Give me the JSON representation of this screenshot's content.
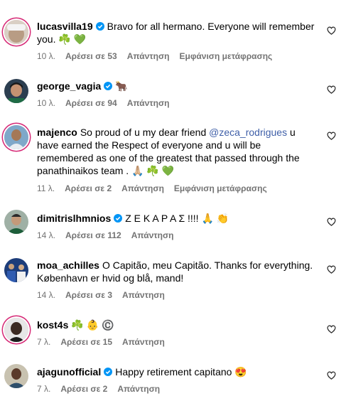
{
  "comments": [
    {
      "username": "lucasvilla19",
      "text": "Bravo for all hermano. Everyone will remember you. ☘️ 💚",
      "time": "10 λ.",
      "likes": "Αρέσει σε 53",
      "reply": "Απάντηση",
      "translate": "Εμφάνιση μετάφρασης"
    },
    {
      "username": "george_vagia",
      "text": "🐂",
      "time": "10 λ.",
      "likes": "Αρέσει σε 94",
      "reply": "Απάντηση"
    },
    {
      "username": "majenco",
      "text_before": "So proud of u my dear friend ",
      "mention": "@zeca_rodrigues",
      "text_after": " u have earned the Respect of everyone and u will be remembered as one of the greatest that passed through the panathinaikos team . 🙏🏼 ☘️ 💚",
      "time": "11 λ.",
      "likes": "Αρέσει σε 2",
      "reply": "Απάντηση",
      "translate": "Εμφάνιση μετάφρασης"
    },
    {
      "username": "dimitrislhmnios",
      "text": "Ζ Ε Κ Α Ρ Α Σ !!!! 🙏 👏",
      "time": "14 λ.",
      "likes": "Αρέσει σε 112",
      "reply": "Απάντηση"
    },
    {
      "username": "moa_achilles",
      "text": "O Capitão, meu Capitão. Thanks for everything. København er hvid og blå, mand!",
      "time": "14 λ.",
      "likes": "Αρέσει σε 3",
      "reply": "Απάντηση"
    },
    {
      "username": "kost4s",
      "text": "☘️ 👶 ©️",
      "time": "7 λ.",
      "likes": "Αρέσει σε 15",
      "reply": "Απάντηση"
    },
    {
      "username": "ajagunofficial",
      "text": "Happy retirement capitano 😍",
      "time": "7 λ.",
      "likes": "Αρέσει σε 2",
      "reply": "Απάντηση"
    }
  ],
  "colors": {
    "verified": "#0095f6",
    "mention": "#3f5fa8",
    "meta": "#737373",
    "story_ring": "#d62976"
  },
  "icons": {
    "verified": "verified-badge-icon",
    "like": "heart-outline-icon"
  }
}
